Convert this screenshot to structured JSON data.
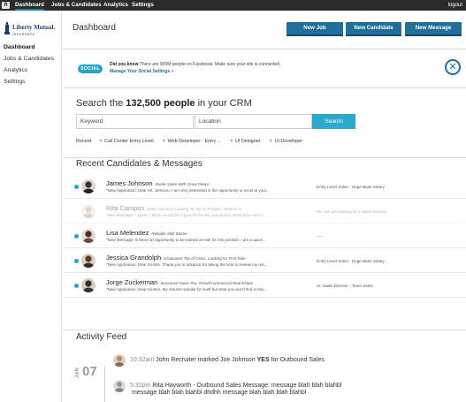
{
  "topbar": {
    "logo": "R",
    "nav": [
      "Dashboard",
      "Jobs & Candidates",
      "Analytics",
      "Settings"
    ],
    "logout": "logout"
  },
  "sidebar": {
    "brand_name": "Liberty Mutual.",
    "brand_sub": "INSURANCE",
    "items": [
      "Dashboard",
      "Jobs & Candidates",
      "Analytics",
      "Settings"
    ]
  },
  "header": {
    "title": "Dashboard",
    "buttons": [
      "New Job",
      "New Candidate",
      "New Message"
    ]
  },
  "social": {
    "badge": "SOCIAL",
    "did_you_know": "Did you know",
    "text": "There are 900M people on Facebook. Make sure your site is connected.",
    "link": "Manage Your Social Settings »"
  },
  "search": {
    "heading_pre": "Search the",
    "heading_count": "132,500 people",
    "heading_post": "in your CRM",
    "keyword_placeholder": "Keyword",
    "location_placeholder": "Location",
    "button": "Search",
    "recent_label": "Recent",
    "recent": [
      "Call Center Entry Level",
      "Web Developer - Entry ...",
      "UI Designer",
      "UI Developer"
    ]
  },
  "candidates": {
    "heading": "Recent Candidates & Messages",
    "rows": [
      {
        "name": "James Johnson",
        "title": "Inside Sales With Great Peeps",
        "message": "\"New Application: Dear Mr. Johnson, I am very interested in the opportunity to excel at your...",
        "job": "Entry Level Sales - Huge Base Salary"
      },
      {
        "name": "Rita Campos",
        "title": "Sales Advance Looking To Top In Product / Believe In",
        "message": "\"New Message: I agree, I think I would be a good fit for this opportunity. What time can I c...",
        "job": "Re: We are looking for a Sales Director"
      },
      {
        "name": "Lisa Melendez",
        "title": "Reliable Skill Starter",
        "message": "\"New Message: Is there an opportunity to be trained on-site for this position. I am a quick...",
        "job": "----"
      },
      {
        "name": "Jessica Grandolph",
        "title": "Graduated Top of Class, Looking for First Role",
        "message": "\"New Application: Dear Kirsten. Thank you in advance for taking the time to review my res...",
        "job": "Entry Level Sales - Huge Base Salary"
      },
      {
        "name": "Jorge Zuckerman",
        "title": "Seasoned Sales Pro, Retail/Commercial Real Estate",
        "message": "\"New Application: Dear Kirsten, My resume speaks for itself but what you won't find in this...",
        "job": "Sr. Sales Director - Team Sales"
      }
    ]
  },
  "activity": {
    "heading": "Activity Feed",
    "month": "JAN",
    "day": "07",
    "items": [
      {
        "time": "10:32am",
        "pre": "John Recruiter marked Joe Johnson",
        "bold": "YES",
        "post": "for Outbound Sales"
      },
      {
        "time": "5:32pm",
        "pre": "Rita Hayworth - Outbound Sales  Message: message blah blah blahbl",
        "line2": "message blah blah blahbl dhdhh message blah blah blah blahbl"
      }
    ]
  },
  "colors": {
    "topbar": "#2b2b2b",
    "button": "#1f6f9a",
    "accent": "#26a4c4"
  }
}
